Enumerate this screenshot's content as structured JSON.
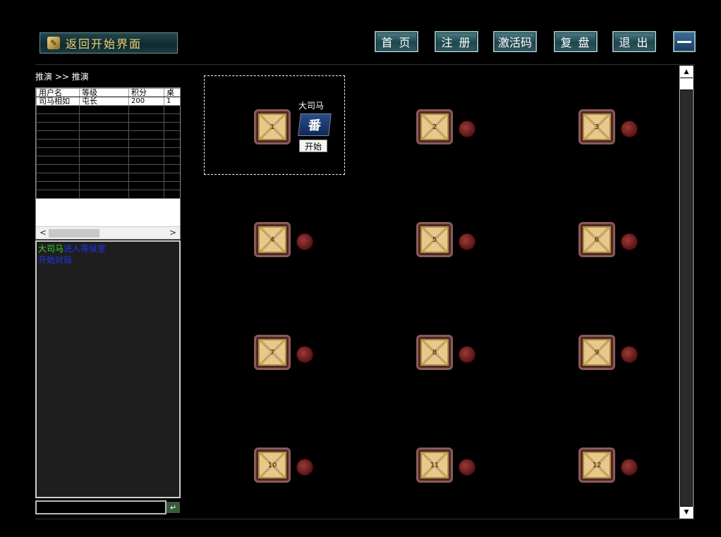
{
  "header": {
    "back_label": "返回开始界面",
    "nav": [
      {
        "label": "首 页"
      },
      {
        "label": "注 册"
      },
      {
        "label": "激活码"
      },
      {
        "label": "复 盘"
      },
      {
        "label": "退 出"
      }
    ]
  },
  "breadcrumb": "推演 >> 推演",
  "user_table": {
    "columns": [
      "用户名",
      "等级",
      "积分",
      "桌"
    ],
    "rows": [
      [
        "司马相如",
        "屯长",
        "200",
        "1"
      ]
    ]
  },
  "chat": {
    "lines": [
      {
        "name": "大司马",
        "text": "进入等候室"
      },
      {
        "name": "",
        "text": "开始对局"
      }
    ],
    "name_color": "#35d435",
    "text_color": "#2233ee"
  },
  "game_tables": [
    {
      "number": "1",
      "player": "大司马",
      "avatar_glyph": "番",
      "start_label": "开始"
    },
    {
      "number": "2"
    },
    {
      "number": "3"
    },
    {
      "number": "4"
    },
    {
      "number": "5"
    },
    {
      "number": "6"
    },
    {
      "number": "7"
    },
    {
      "number": "8"
    },
    {
      "number": "9"
    },
    {
      "number": "10"
    },
    {
      "number": "11"
    },
    {
      "number": "12"
    }
  ],
  "colors": {
    "background": "#000000",
    "button_teal": "#2d5a60",
    "back_text": "#f0d36b",
    "seat": "#7a2020"
  }
}
